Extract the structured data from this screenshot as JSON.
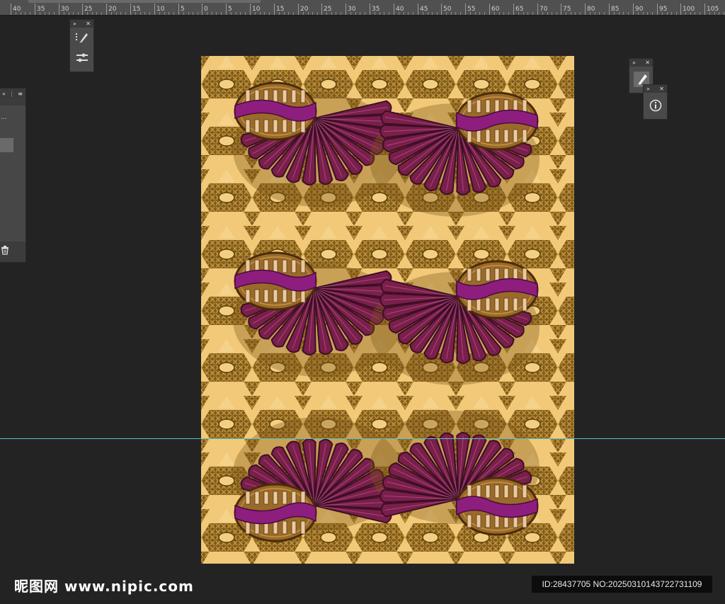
{
  "ruler": {
    "labels": [
      "40",
      "35",
      "30",
      "25",
      "20",
      "15",
      "10",
      "5",
      "0",
      "5",
      "10",
      "15",
      "20",
      "25",
      "30",
      "35",
      "40",
      "45",
      "50",
      "55",
      "60",
      "65",
      "70",
      "75",
      "80",
      "85",
      "90",
      "95",
      "100",
      "105"
    ]
  },
  "panels": {
    "tools": {
      "expand": "»",
      "close": "✕"
    },
    "layers": {
      "collapse": "«",
      "divider": "|",
      "menu": "≡",
      "item_text": "...",
      "trash": "🗑"
    },
    "brush": {
      "expand": "»",
      "close": "✕"
    },
    "info": {
      "expand": "»",
      "close": "✕",
      "icon": "ⓘ"
    }
  },
  "colors": {
    "workspace": "#232323",
    "background_tan": "#f1c978",
    "pattern_brown": "#8a6521",
    "pattern_dark": "#5c3d0c",
    "fan_purple": "#7a1f4c",
    "fan_dark": "#3d0f24",
    "basket_brown": "#9a6a2a",
    "band_magenta": "#8e1e7e",
    "guide": "#5fc2c6"
  },
  "watermark": {
    "logo": "昵图网 www.nipic.com",
    "id": "ID:28437705 NO:20250310143722731109"
  }
}
